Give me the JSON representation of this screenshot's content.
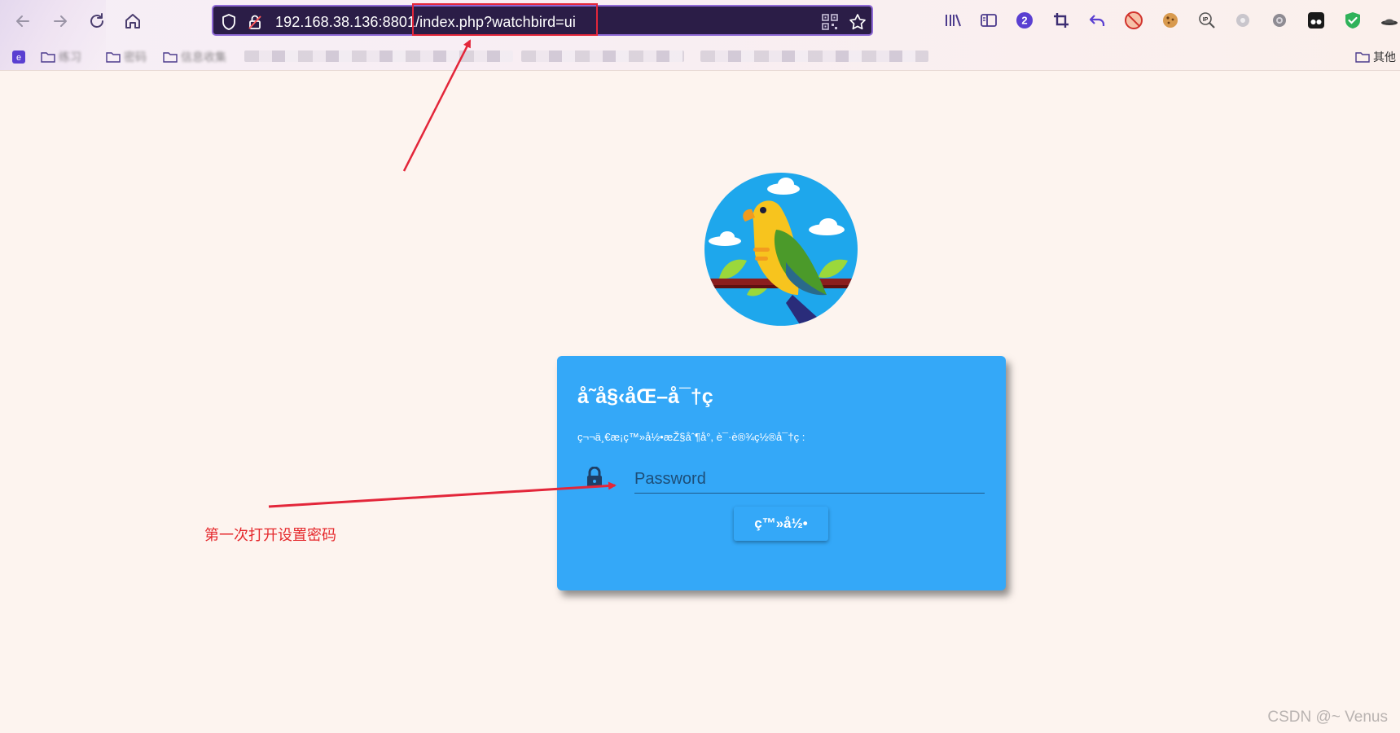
{
  "browser": {
    "url": "192.168.38.136:8801/index.php?watchbird=ui",
    "toolbar": {
      "pocket_badge": "2"
    },
    "bookmarks": {
      "items": [
        "练习",
        "密码",
        "信息收集"
      ],
      "other_label": "其他"
    }
  },
  "page": {
    "card": {
      "title": "å˜å§‹åŒ–å¯†ç",
      "subtitle": "ç¬¬ä¸€æ¡ç™»å½•æŽ§åˆ¶å°, è¯·è®¾ç½®å¯†ç :",
      "password_placeholder": "Password",
      "button_label": "ç™»å½•"
    }
  },
  "annotation": {
    "text": "第一次打开设置密码",
    "color": "#e5282c"
  },
  "watermark": "CSDN @~ Venus",
  "colors": {
    "card": "#34a8f8",
    "urlbar": "#2b1d47",
    "highlight": "#e3263a",
    "page_bg": "#fdf4ef"
  }
}
